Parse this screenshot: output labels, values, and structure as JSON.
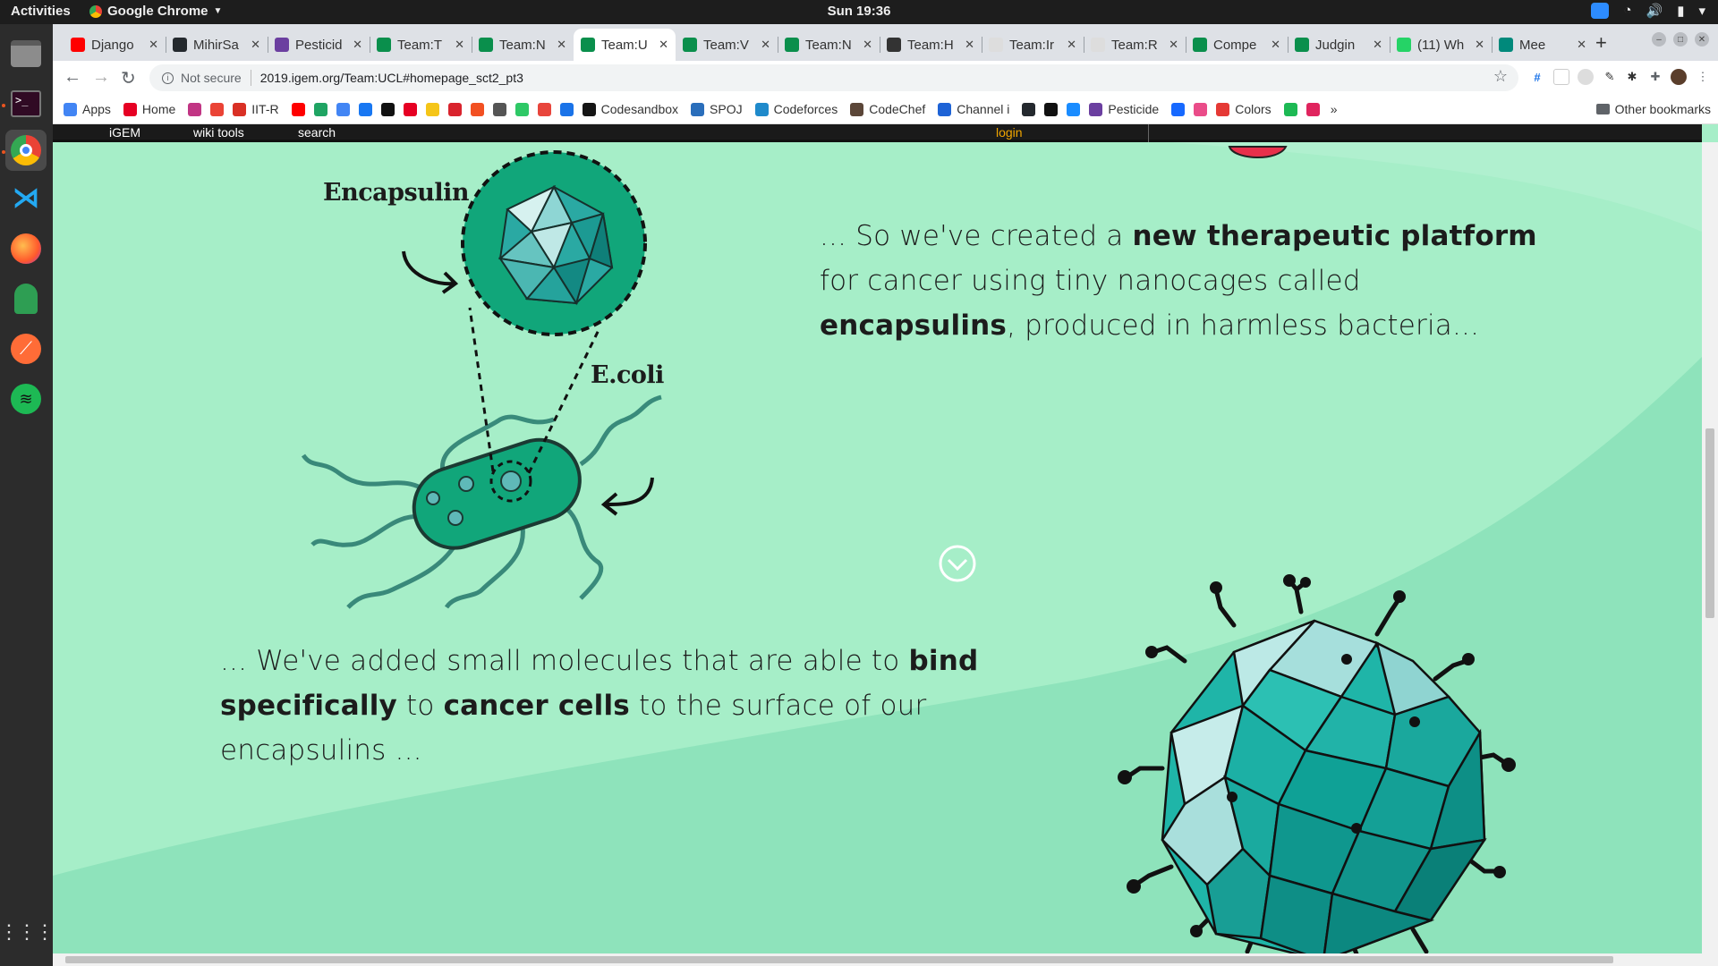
{
  "system": {
    "activities": "Activities",
    "app_name": "Google Chrome",
    "clock": "Sun 19:36"
  },
  "tabs": [
    {
      "title": "Django",
      "icon_color": "#ff0000",
      "active": false
    },
    {
      "title": "MihirSa",
      "icon_color": "#24292e",
      "active": false
    },
    {
      "title": "Pesticid",
      "icon_color": "#6b3fa0",
      "active": false
    },
    {
      "title": "Team:T",
      "icon_color": "#0a8f4c",
      "active": false
    },
    {
      "title": "Team:N",
      "icon_color": "#0a8f4c",
      "active": false
    },
    {
      "title": "Team:U",
      "icon_color": "#0a8f4c",
      "active": true
    },
    {
      "title": "Team:V",
      "icon_color": "#0a8f4c",
      "active": false
    },
    {
      "title": "Team:N",
      "icon_color": "#0a8f4c",
      "active": false
    },
    {
      "title": "Team:H",
      "icon_color": "#333333",
      "active": false
    },
    {
      "title": "Team:Ir",
      "icon_color": "#dddddd",
      "active": false
    },
    {
      "title": "Team:R",
      "icon_color": "#dddddd",
      "active": false
    },
    {
      "title": "Compe",
      "icon_color": "#0a8f4c",
      "active": false
    },
    {
      "title": "Judgin",
      "icon_color": "#0a8f4c",
      "active": false
    },
    {
      "title": "(11) Wh",
      "icon_color": "#25d366",
      "active": false
    },
    {
      "title": "Mee",
      "icon_color": "#00897b",
      "active": false
    }
  ],
  "toolbar": {
    "security_label": "Not secure",
    "url": "2019.igem.org/Team:UCL#homepage_sct2_pt3"
  },
  "bookmarks": {
    "items": [
      {
        "label": "Apps",
        "color": "#4285f4"
      },
      {
        "label": "Home",
        "color": "#e60023"
      },
      {
        "label": "",
        "color": "#c13584"
      },
      {
        "label": "",
        "color": "#ea4335"
      },
      {
        "label": "IIT-R",
        "color": "#d93025"
      },
      {
        "label": "",
        "color": "#ff0000"
      },
      {
        "label": "",
        "color": "#1fa463"
      },
      {
        "label": "",
        "color": "#4285f4"
      },
      {
        "label": "",
        "color": "#1877f2"
      },
      {
        "label": "",
        "color": "#111111"
      },
      {
        "label": "",
        "color": "#e60023"
      },
      {
        "label": "",
        "color": "#f5c518"
      },
      {
        "label": "",
        "color": "#d9232d"
      },
      {
        "label": "",
        "color": "#f25022"
      },
      {
        "label": "",
        "color": "#555555"
      },
      {
        "label": "",
        "color": "#2ec866"
      },
      {
        "label": "",
        "color": "#e8453c"
      },
      {
        "label": "",
        "color": "#1a73e8"
      },
      {
        "label": "Codesandbox",
        "color": "#151515"
      },
      {
        "label": "SPOJ",
        "color": "#2a6ebb"
      },
      {
        "label": "Codeforces",
        "color": "#1f8acb"
      },
      {
        "label": "CodeChef",
        "color": "#5b4638"
      },
      {
        "label": "Channel i",
        "color": "#1e63d6"
      },
      {
        "label": "",
        "color": "#24292e"
      },
      {
        "label": "",
        "color": "#111111"
      },
      {
        "label": "",
        "color": "#1a8cff"
      },
      {
        "label": "Pesticide",
        "color": "#6b3fa0"
      },
      {
        "label": "",
        "color": "#1769ff"
      },
      {
        "label": "",
        "color": "#ea4c89"
      },
      {
        "label": "Colors",
        "color": "#e53935"
      },
      {
        "label": "",
        "color": "#1db954"
      },
      {
        "label": "",
        "color": "#e0245e"
      }
    ],
    "overflow": "»",
    "other": "Other bookmarks"
  },
  "igem_bar": {
    "igem": "iGEM",
    "wiki_tools": "wiki tools",
    "search": "search",
    "login": "login"
  },
  "page": {
    "label_encapsulin": "Encapsulin",
    "label_ecoli": "E.coli",
    "para1": {
      "t1": "... So we've created a ",
      "b1": "new therapeutic platform",
      "t2": " for cancer using tiny nanocages called ",
      "b2": "encapsulins",
      "t3": ", produced in harmless bacteria..."
    },
    "para2": {
      "t1": "... We've added small molecules that are able to ",
      "b1": "bind specifically",
      "t2": " to ",
      "b2": "cancer cells",
      "t3": " to the surface of our encapsulins ..."
    },
    "colors": {
      "background": "#a6eec8",
      "wave": "#8ee3bb",
      "accent": "#11a67a",
      "cage_teal": "#1fb5a8",
      "login": "#f0a500"
    }
  }
}
